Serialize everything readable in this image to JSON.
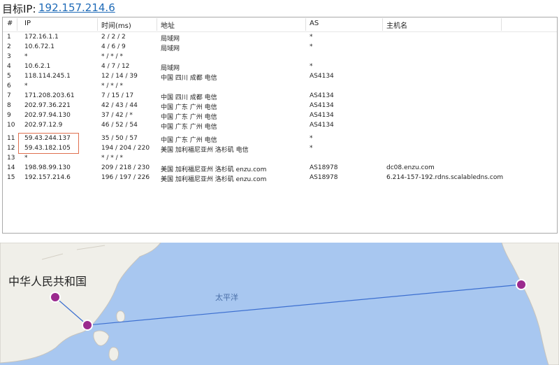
{
  "target": {
    "label": "目标IP:",
    "ip": "192.157.214.6"
  },
  "columns": [
    "#",
    "IP",
    "时间(ms)",
    "地址",
    "AS",
    "主机名"
  ],
  "rows": [
    {
      "num": "1",
      "ip": "172.16.1.1",
      "time": "2 / 2 / 2",
      "addr": "局域网",
      "as": "*",
      "host": ""
    },
    {
      "num": "2",
      "ip": "10.6.72.1",
      "time": "4 / 6 / 9",
      "addr": "局域网",
      "as": "*",
      "host": ""
    },
    {
      "num": "3",
      "ip": "*",
      "time": "* / * / *",
      "addr": "",
      "as": "",
      "host": ""
    },
    {
      "num": "4",
      "ip": "10.6.2.1",
      "time": "4 / 7 / 12",
      "addr": "局域网",
      "as": "*",
      "host": ""
    },
    {
      "num": "5",
      "ip": "118.114.245.1",
      "time": "12 / 14 / 39",
      "addr": "中国 四川 成都 电信",
      "as": "AS4134",
      "host": ""
    },
    {
      "num": "6",
      "ip": "*",
      "time": "* / * / *",
      "addr": "",
      "as": "",
      "host": ""
    },
    {
      "num": "7",
      "ip": "171.208.203.61",
      "time": "7 / 15 / 17",
      "addr": "中国 四川 成都 电信",
      "as": "AS4134",
      "host": ""
    },
    {
      "num": "8",
      "ip": "202.97.36.221",
      "time": "42 / 43 / 44",
      "addr": "中国 广东 广州 电信",
      "as": "AS4134",
      "host": ""
    },
    {
      "num": "9",
      "ip": "202.97.94.130",
      "time": "37 / 42 / *",
      "addr": "中国 广东 广州 电信",
      "as": "AS4134",
      "host": ""
    },
    {
      "num": "10",
      "ip": "202.97.12.9",
      "time": "46 / 52 / 54",
      "addr": "中国 广东 广州 电信",
      "as": "AS4134",
      "host": ""
    },
    {
      "num": "11",
      "ip": "59.43.244.137",
      "time": "35 / 50 / 57",
      "addr": "中国 广东 广州 电信",
      "as": "*",
      "host": ""
    },
    {
      "num": "12",
      "ip": "59.43.182.105",
      "time": "194 / 204 / 220",
      "addr": "美国 加利福尼亚州 洛杉矶 电信",
      "as": "*",
      "host": ""
    },
    {
      "num": "13",
      "ip": "*",
      "time": "* / * / *",
      "addr": "",
      "as": "",
      "host": ""
    },
    {
      "num": "14",
      "ip": "198.98.99.130",
      "time": "209 / 218 / 230",
      "addr": "美国 加利福尼亚州 洛杉矶 enzu.com",
      "as": "AS18978",
      "host": "dc08.enzu.com"
    },
    {
      "num": "15",
      "ip": "192.157.214.6",
      "time": "196 / 197 / 226",
      "addr": "美国 加利福尼亚州 洛杉矶 enzu.com",
      "as": "AS18978",
      "host": "6.214-157-192.rdns.scalabledns.com"
    }
  ],
  "map": {
    "country_label": "中华人民共和国",
    "ocean_label": "太平洋",
    "colors": {
      "water": "#a8c7f0",
      "land": "#f0efe9",
      "route": "#3c6fd0",
      "marker": "#9b2a8e"
    }
  }
}
